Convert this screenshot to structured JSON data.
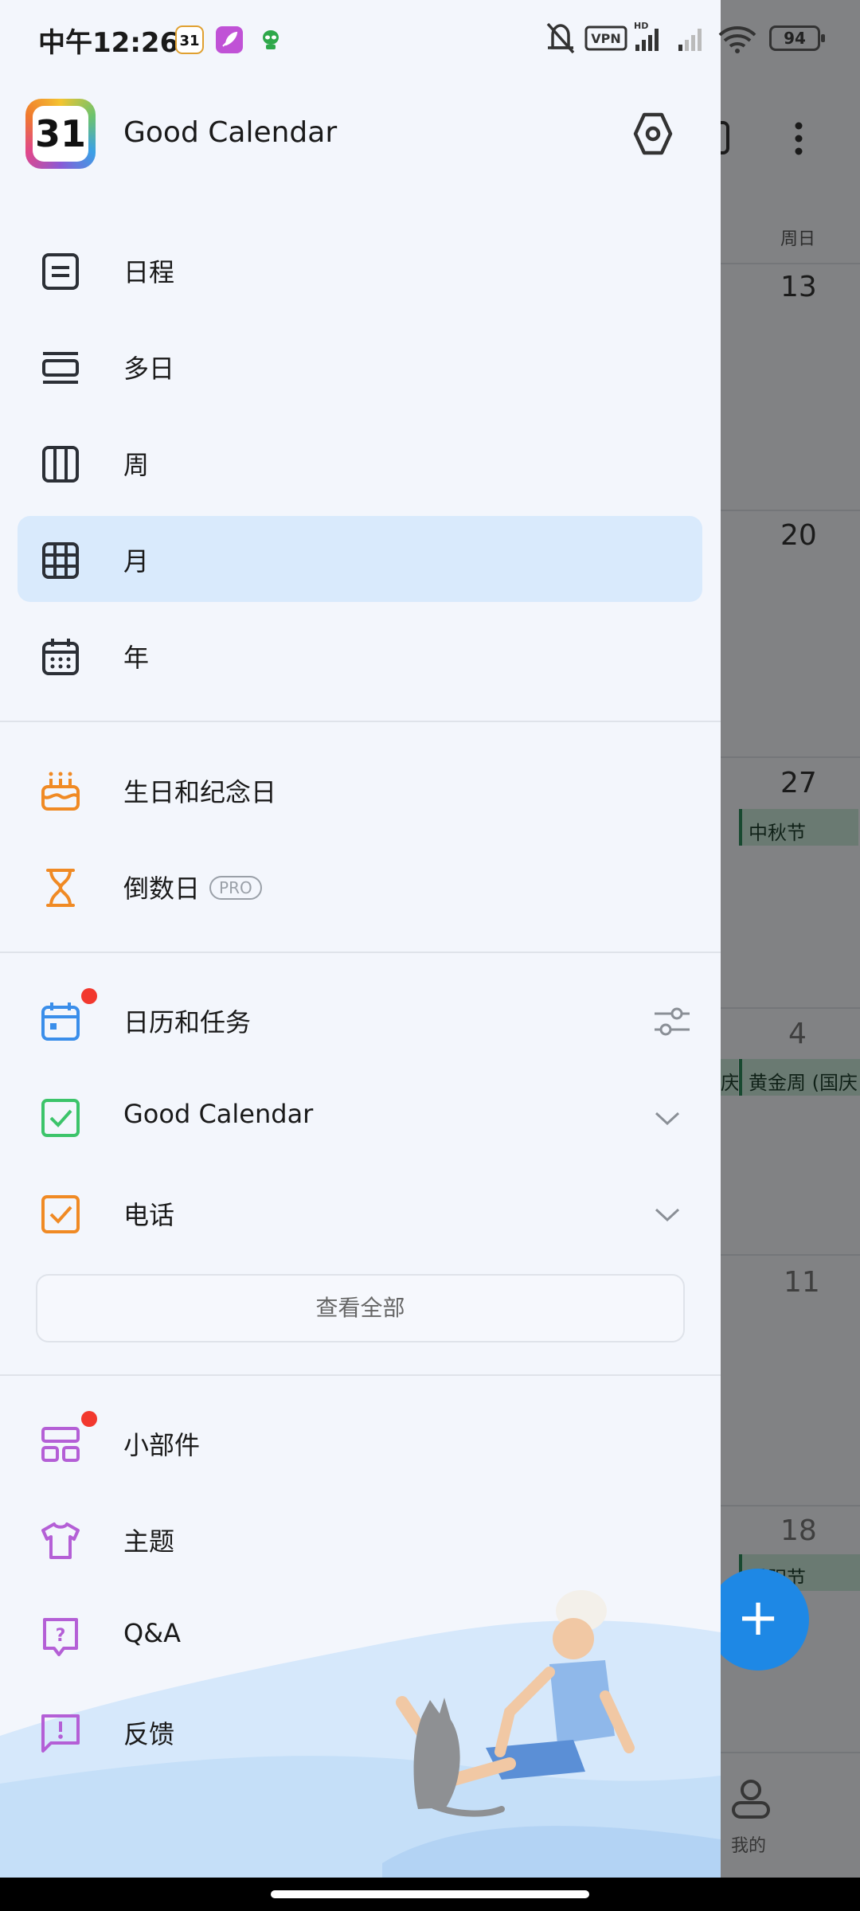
{
  "status_bar": {
    "time": "中午12:26",
    "battery": "94",
    "vpn_label": "VPN"
  },
  "background_calendar": {
    "weekday_label": "周日",
    "days": [
      "13",
      "20",
      "27",
      "4",
      "11",
      "18"
    ],
    "events": {
      "mid_autumn": "中秋节",
      "golden_week_left": "庆",
      "golden_week": "黄金周 (国庆",
      "double_ninth": "重阳节"
    },
    "fab_label": "+",
    "bottom_tab_label": "我的"
  },
  "drawer": {
    "app_title": "Good Calendar",
    "app_logo_text": "31",
    "views": [
      {
        "label": "日程",
        "icon": "agenda-icon"
      },
      {
        "label": "多日",
        "icon": "multi-day-icon"
      },
      {
        "label": "周",
        "icon": "week-icon"
      },
      {
        "label": "月",
        "icon": "month-icon",
        "active": true
      },
      {
        "label": "年",
        "icon": "year-icon"
      }
    ],
    "special": [
      {
        "label": "生日和纪念日",
        "icon": "birthday-cake-icon"
      },
      {
        "label": "倒数日",
        "icon": "hourglass-icon",
        "badge": "PRO"
      }
    ],
    "calendars_header": "日历和任务",
    "calendars": [
      {
        "label": "Good Calendar",
        "color": "#3cc46a"
      },
      {
        "label": "电话",
        "color": "#f08a24"
      }
    ],
    "view_all": "查看全部",
    "extras": [
      {
        "label": "小部件",
        "icon": "widget-icon"
      },
      {
        "label": "主题",
        "icon": "shirt-icon"
      },
      {
        "label": "Q&A",
        "icon": "qa-icon"
      },
      {
        "label": "反馈",
        "icon": "feedback-icon"
      }
    ]
  },
  "colors": {
    "accent_blue": "#1e88e5",
    "active_bg": "#d9eafc",
    "orange": "#f08a24",
    "purple": "#b45fd6",
    "badge_red": "#f2382e"
  }
}
